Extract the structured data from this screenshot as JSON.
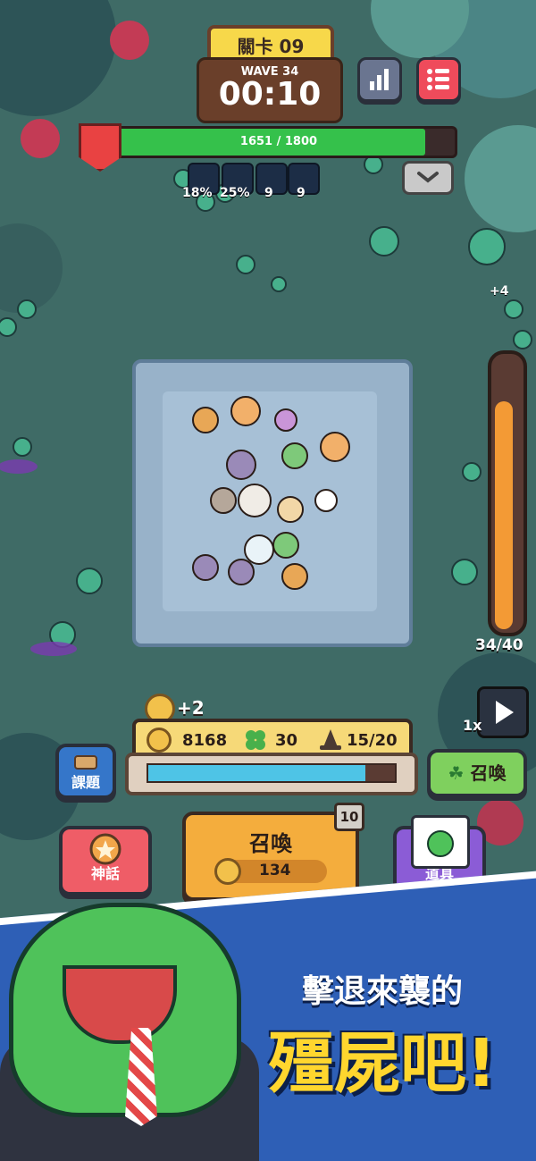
{
  "top": {
    "stage_label": "關卡 09",
    "wave_label": "WAVE 34",
    "timer": "00:10",
    "hp_text": "1651 / 1800",
    "hp_fraction": 0.917
  },
  "buffs": [
    {
      "icon": "sword-up-icon",
      "value": "18%"
    },
    {
      "icon": "speed-up-icon",
      "value": "25%"
    },
    {
      "icon": "shield-up-icon",
      "value": "9"
    },
    {
      "icon": "power-up-icon",
      "value": "9"
    }
  ],
  "enemy_bonus": "+4",
  "gauge": {
    "label": "34/40",
    "fraction": 0.85
  },
  "speed": {
    "label": "1x"
  },
  "resources": {
    "coin_gain": "+2",
    "coins": "8168",
    "clover": "30",
    "units": "15/20",
    "energy_fraction": 0.88
  },
  "buttons": {
    "quest": "課題",
    "summon_small": "召喚",
    "myth": "神話",
    "summon_main": "召喚",
    "summon_cost": "134",
    "summon_count": "10",
    "items": "道具"
  },
  "promo": {
    "line1": "擊退來襲的",
    "line2": "殭屍吧!"
  },
  "colors": {
    "hp": "#35c14b",
    "energy": "#4ec4e6",
    "banner": "#2e5fb6",
    "promo_highlight": "#ffd62e"
  }
}
